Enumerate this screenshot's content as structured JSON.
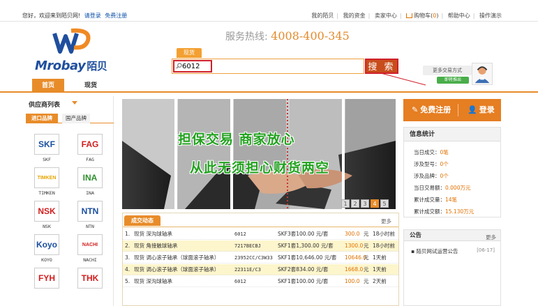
{
  "topbar": {
    "welcome": "您好，欢迎来到陌贝网!",
    "login": "请登录",
    "register": "免费注册",
    "links": [
      "我的陌贝",
      "我的资金",
      "卖家中心"
    ],
    "cart_label": "购物车",
    "cart_count": "0",
    "help": "帮助中心",
    "demo": "操作演示"
  },
  "header": {
    "logo_text": "Mrobay",
    "logo_cn": "陌贝",
    "hotline_label": "服务热线:",
    "hotline_number": "4008-400-345",
    "search_tab": "现货",
    "search_value": "6012",
    "search_button": "搜 索",
    "more_trade": "更多交易方式",
    "more_trade_go": "即将推出"
  },
  "nav": {
    "tabs": [
      "首页",
      "现货"
    ]
  },
  "sidebar": {
    "title": "供应商列表",
    "tabs": [
      "进口品牌",
      "国产品牌"
    ],
    "brands": [
      {
        "logo": "SKF",
        "name": "SKF",
        "color": "#1a4fa0"
      },
      {
        "logo": "FAG",
        "name": "FAG",
        "color": "#d21d1d"
      },
      {
        "logo": "TIMKEN",
        "name": "TIMKEN",
        "color": "#e7a500"
      },
      {
        "logo": "INA",
        "name": "INA",
        "color": "#2f8f2f"
      },
      {
        "logo": "NSK",
        "name": "NSK",
        "color": "#d21d1d"
      },
      {
        "logo": "NTN",
        "name": "NTN",
        "color": "#1a4fa0"
      },
      {
        "logo": "Koyo",
        "name": "KOYO",
        "color": "#1a4fa0"
      },
      {
        "logo": "NACHI",
        "name": "NACHI",
        "color": "#d21d1d"
      },
      {
        "logo": "FYH",
        "name": "",
        "color": "#d21d1d"
      },
      {
        "logo": "THK",
        "name": "",
        "color": "#d21d1d"
      }
    ]
  },
  "banner": {
    "line1": "担保交易  商家放心",
    "line2": "从此无须担心财货两空",
    "slides": [
      "1",
      "2",
      "3",
      "4",
      "5"
    ],
    "active_slide": "4"
  },
  "trades": {
    "title": "成交动态",
    "more": "更多",
    "rows": [
      {
        "idx": "1.",
        "name": "现货 深沟球轴承",
        "model": "6012",
        "qty": "SKF3套100.00 元/套",
        "price": "300.0",
        "unit": "元",
        "time": "18小时前"
      },
      {
        "idx": "2.",
        "name": "现货 角接触球轴承",
        "model": "7217BECBJ",
        "qty": "SKF1套1,300.00 元/套",
        "price": "1300.0",
        "unit": "元",
        "time": "18小时前"
      },
      {
        "idx": "3.",
        "name": "现货 调心滚子轴承（球面滚子轴承）",
        "model": "23952CC/C3W33",
        "qty": "SKF1套10,646.00 元/套",
        "price": "10646.0",
        "unit": "元",
        "time": "1天前"
      },
      {
        "idx": "4.",
        "name": "现货 调心滚子轴承（球面滚子轴承）",
        "model": "22311E/C3",
        "qty": "SKF2套834.00 元/套",
        "price": "1668.0",
        "unit": "元",
        "time": "1天前"
      },
      {
        "idx": "5.",
        "name": "现货 深沟球轴承",
        "model": "6012",
        "qty": "SKF1套100.00 元/套",
        "price": "100.0",
        "unit": "元",
        "time": "2天前"
      }
    ]
  },
  "account": {
    "register": "免费注册",
    "login": "登录"
  },
  "info": {
    "title": "信息统计",
    "rows": [
      {
        "label": "当日成交：",
        "value": "0笔"
      },
      {
        "label": "涉及型号：",
        "value": "0个"
      },
      {
        "label": "涉及品牌：",
        "value": "0个"
      },
      {
        "label": "当日交易额：",
        "value": "0.000万元"
      },
      {
        "label": "累计成交量：",
        "value": "14笔"
      },
      {
        "label": "累计成交额：",
        "value": "15.130万元"
      }
    ]
  },
  "notice": {
    "title": "公告",
    "more": "更多",
    "item": "▪ 陌贝网试运营公告",
    "date": "[06-17]"
  }
}
